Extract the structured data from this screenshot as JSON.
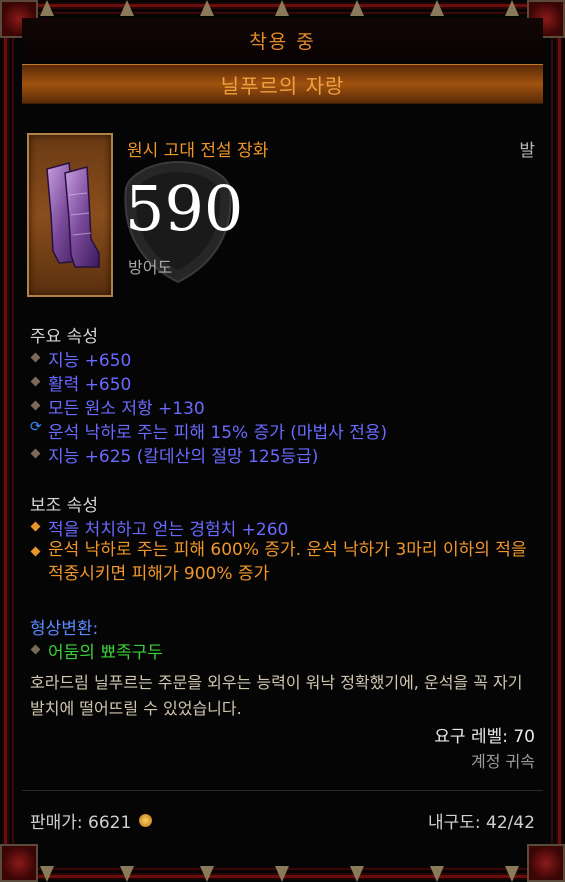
{
  "header": {
    "equipped_label": "착용 중",
    "item_name": "닐푸르의 자랑"
  },
  "item": {
    "type": "원시 고대 전설 장화",
    "slot": "발",
    "armor_value": "590",
    "armor_label": "방어도"
  },
  "primary": {
    "title": "주요 속성",
    "stats": [
      {
        "text": "지능 +650",
        "bullet": "diamond"
      },
      {
        "text": "활력 +650",
        "bullet": "diamond"
      },
      {
        "text": "모든 원소 저항 +130",
        "bullet": "diamond"
      },
      {
        "text": "운석 낙하로 주는 피해 15% 증가 (마법사 전용)",
        "bullet": "enchant"
      },
      {
        "text": "지능 +625 (칼데산의 절망 125등급)",
        "bullet": "diamond"
      }
    ]
  },
  "secondary": {
    "title": "보조 속성",
    "stats": [
      {
        "text": "적을 처치하고 얻는 경험치 +260",
        "bullet": "gold-diamond"
      },
      {
        "text": "운석 낙하로 주는 피해 600% 증가. 운석 낙하가 3마리 이하의 적을 적중시키면 피해가 900% 증가",
        "bullet": "gold-diamond"
      }
    ]
  },
  "transmog": {
    "title": "형상변환:",
    "value": "어둠의 뾰족구두"
  },
  "flavor_text": "호라드림 닐푸르는 주문을 외우는 능력이 워낙 정확했기에, 운석을 꼭 자기 발치에 떨어뜨릴 수 있었습니다.",
  "requirements": {
    "level_label": "요구 레벨: 70",
    "bound": "계정 귀속"
  },
  "footer": {
    "sell_label": "판매가: 6621",
    "durability": "내구도: 42/42"
  },
  "colors": {
    "legendary_orange": "#f0962a",
    "magic_blue": "#6a6aff",
    "set_green": "#3ad03a",
    "frame_red": "#6a0d0d"
  }
}
